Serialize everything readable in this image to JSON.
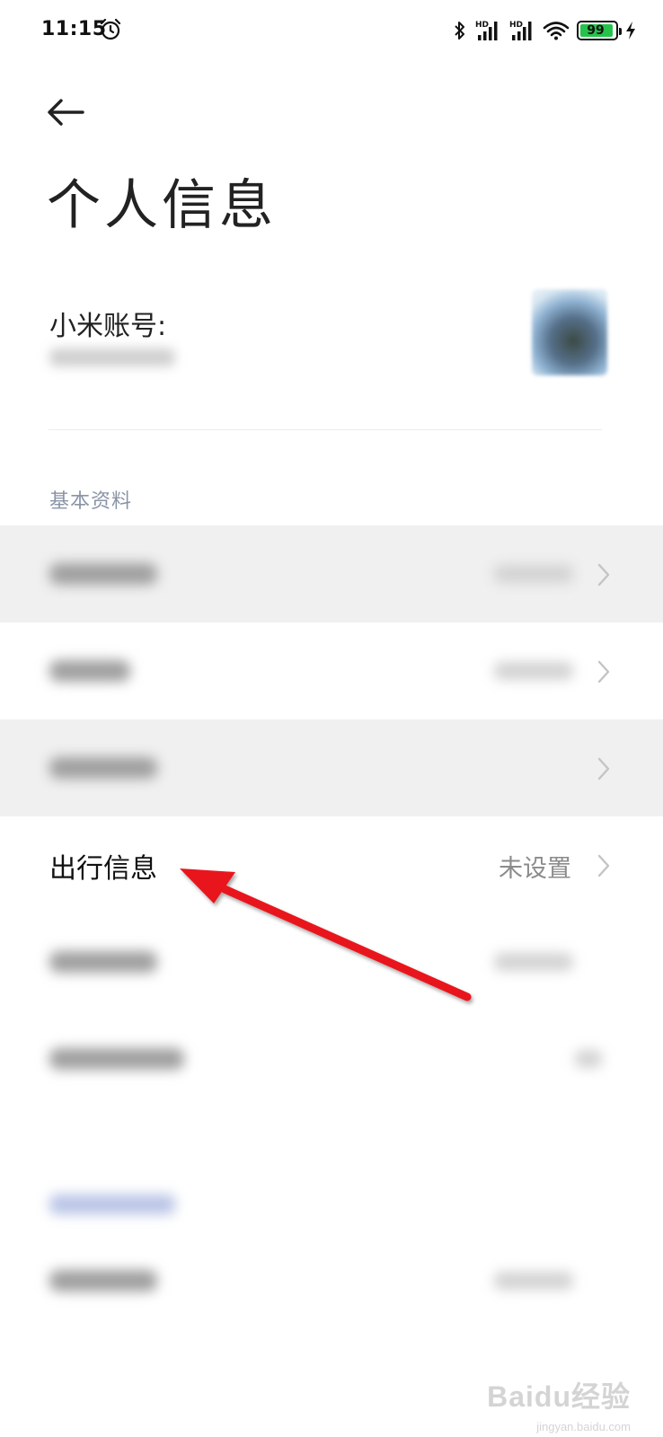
{
  "status_bar": {
    "time": "11:15",
    "battery": "99",
    "network_badge_1": "HD",
    "network_badge_2": "HD"
  },
  "header": {
    "title": "个人信息"
  },
  "account": {
    "label": "小米账号:"
  },
  "section": {
    "basic_label": "基本资料"
  },
  "rows": [
    {
      "label": "",
      "value": ""
    },
    {
      "label": "",
      "value": ""
    },
    {
      "label": "",
      "value": ""
    },
    {
      "label": "出行信息",
      "value": "未设置"
    },
    {
      "label": "",
      "value": ""
    },
    {
      "label": "",
      "value": ""
    }
  ],
  "watermark": {
    "text": "Baidu经验",
    "sub": "jingyan.baidu.com"
  },
  "colors": {
    "arrow": "#e8141a",
    "section_label": "#8a94a6",
    "battery": "#27c24c"
  }
}
